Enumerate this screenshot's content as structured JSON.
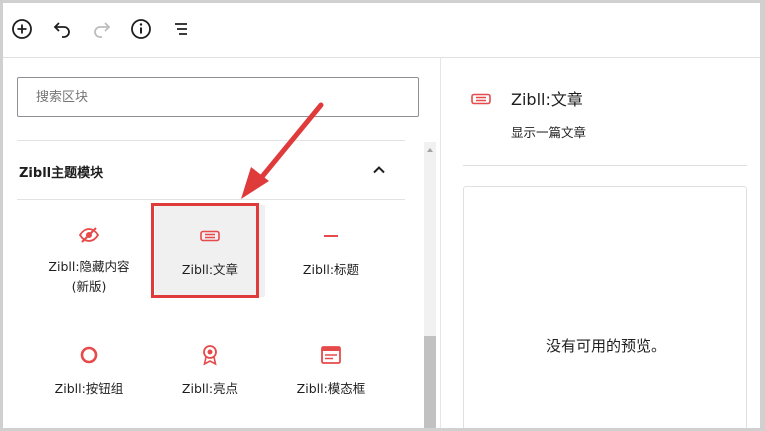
{
  "toolbar": {
    "buttons": [
      {
        "name": "add-block-icon"
      },
      {
        "name": "undo-icon"
      },
      {
        "name": "redo-icon"
      },
      {
        "name": "info-icon"
      },
      {
        "name": "list-view-icon"
      }
    ]
  },
  "search": {
    "placeholder": "搜索区块",
    "value": ""
  },
  "panel": {
    "title": "Zibll主题模块",
    "collapse_icon": "chevron-up-icon",
    "blocks": [
      {
        "label": "Zibll:隐藏内容\n(新版)",
        "icon": "eye-slash-icon"
      },
      {
        "label": "Zibll:文章",
        "icon": "post-ticket-icon",
        "selected": true
      },
      {
        "label": "Zibll:标题",
        "icon": "dash-icon"
      },
      {
        "label": "Zibll:按钮组",
        "icon": "ring-icon"
      },
      {
        "label": "Zibll:亮点",
        "icon": "award-icon"
      },
      {
        "label": "Zibll:模态框",
        "icon": "modal-window-icon"
      }
    ]
  },
  "preview": {
    "icon": "post-ticket-icon",
    "title": "Zibll:文章",
    "description": "显示一篇文章",
    "empty_text": "没有可用的预览。"
  },
  "colors": {
    "accent": "#e03b3b",
    "icon_red": "#e64a4a",
    "text": "#1e1e1e",
    "border": "#e0e0e0"
  }
}
